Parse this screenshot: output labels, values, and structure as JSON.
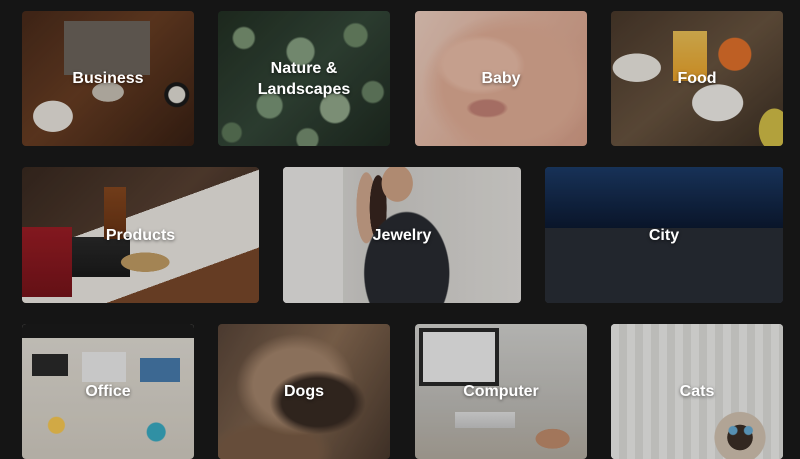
{
  "categories": [
    {
      "id": "business",
      "label": "Business"
    },
    {
      "id": "nature",
      "label": "Nature &\nLandscapes"
    },
    {
      "id": "baby",
      "label": "Baby"
    },
    {
      "id": "food",
      "label": "Food"
    },
    {
      "id": "products",
      "label": "Products"
    },
    {
      "id": "jewelry",
      "label": "Jewelry"
    },
    {
      "id": "city",
      "label": "City"
    },
    {
      "id": "office",
      "label": "Office"
    },
    {
      "id": "dogs",
      "label": "Dogs"
    },
    {
      "id": "computer",
      "label": "Computer"
    },
    {
      "id": "cats",
      "label": "Cats"
    }
  ]
}
